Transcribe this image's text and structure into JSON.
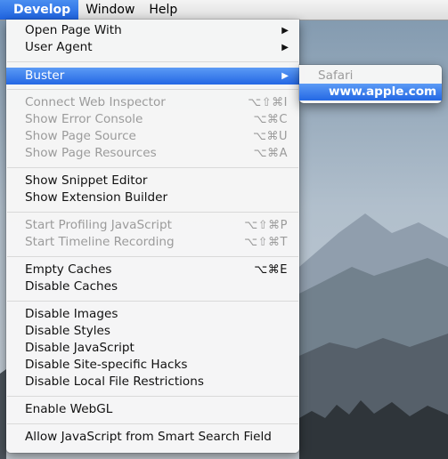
{
  "menubar": {
    "items": [
      {
        "label": "Develop"
      },
      {
        "label": "Window"
      },
      {
        "label": "Help"
      }
    ]
  },
  "menu": {
    "open_page_with": {
      "label": "Open Page With",
      "arrow": "▶"
    },
    "user_agent": {
      "label": "User Agent",
      "arrow": "▶"
    },
    "buster": {
      "label": "Buster",
      "arrow": "▶"
    },
    "connect_web_inspector": {
      "label": "Connect Web Inspector",
      "shortcut": "⌥⇧⌘I"
    },
    "show_error_console": {
      "label": "Show Error Console",
      "shortcut": "⌥⌘C"
    },
    "show_page_source": {
      "label": "Show Page Source",
      "shortcut": "⌥⌘U"
    },
    "show_page_resources": {
      "label": "Show Page Resources",
      "shortcut": "⌥⌘A"
    },
    "show_snippet_editor": {
      "label": "Show Snippet Editor"
    },
    "show_extension_builder": {
      "label": "Show Extension Builder"
    },
    "start_profiling_javascript": {
      "label": "Start Profiling JavaScript",
      "shortcut": "⌥⇧⌘P"
    },
    "start_timeline_recording": {
      "label": "Start Timeline Recording",
      "shortcut": "⌥⇧⌘T"
    },
    "empty_caches": {
      "label": "Empty Caches",
      "shortcut": "⌥⌘E"
    },
    "disable_caches": {
      "label": "Disable Caches"
    },
    "disable_images": {
      "label": "Disable Images"
    },
    "disable_styles": {
      "label": "Disable Styles"
    },
    "disable_javascript": {
      "label": "Disable JavaScript"
    },
    "disable_site_specific_hacks": {
      "label": "Disable Site-specific Hacks"
    },
    "disable_local_file_restrictions": {
      "label": "Disable Local File Restrictions"
    },
    "enable_webgl": {
      "label": "Enable WebGL"
    },
    "allow_javascript_smart_search": {
      "label": "Allow JavaScript from Smart Search Field"
    }
  },
  "submenu": {
    "header": "Safari",
    "selected": "www.apple.com"
  },
  "colors": {
    "highlight": "#2468e4",
    "disabled_text": "#9b9b9b",
    "menu_bg": "#f6f6f6"
  }
}
